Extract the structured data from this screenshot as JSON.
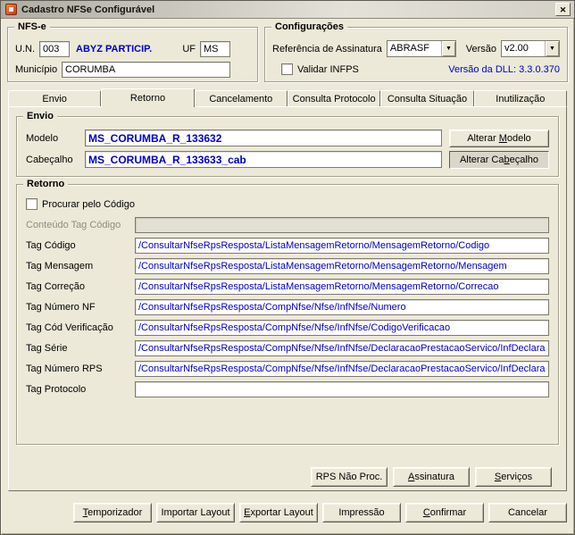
{
  "window": {
    "title": "Cadastro NFSe Configurável"
  },
  "icons": {
    "close": "✕",
    "dropdown": "▼"
  },
  "colors": {
    "accent_blue": "#0000C8",
    "dialog_bg": "#ECE9D8"
  },
  "nfse": {
    "title": "NFS-e",
    "un_label": "U.N.",
    "un_value": "003",
    "participante": "ABYZ PARTICIP.",
    "uf_label": "UF",
    "uf_value": "MS",
    "municipio_label": "Município",
    "municipio_value": "CORUMBA"
  },
  "config": {
    "title": "Configurações",
    "referencia_label": "Referência de Assinatura",
    "referencia_value": "ABRASF",
    "versao_label": "Versão",
    "versao_value": "v2.00",
    "validar_infps_label": "Validar INFPS",
    "dll_versao": "Versão da DLL: 3.3.0.370"
  },
  "tabs": [
    "Envio",
    "Retorno",
    "Cancelamento",
    "Consulta Protocolo",
    "Consulta Situação",
    "Inutilização"
  ],
  "active_tab": "Retorno",
  "envio": {
    "title": "Envio",
    "modelo_label": "Modelo",
    "modelo_value": "MS_CORUMBA_R_133632",
    "alterar_modelo": {
      "label": "Alterar Modelo",
      "accel": 8
    },
    "cabecalho_label": "Cabeçalho",
    "cabecalho_value": "MS_CORUMBA_R_133633_cab",
    "alterar_cabecalho": {
      "label": "Alterar Cabeçalho",
      "accel": 10
    }
  },
  "retorno": {
    "title": "Retorno",
    "procurar_label": "Procurar pelo Código",
    "rows": [
      {
        "label": "Conteúdo Tag Código",
        "value": "",
        "disabled": true
      },
      {
        "label": "Tag Código",
        "value": "/ConsultarNfseRpsResposta/ListaMensagemRetorno/MensagemRetorno/Codigo"
      },
      {
        "label": "Tag Mensagem",
        "value": "/ConsultarNfseRpsResposta/ListaMensagemRetorno/MensagemRetorno/Mensagem"
      },
      {
        "label": "Tag Correção",
        "value": "/ConsultarNfseRpsResposta/ListaMensagemRetorno/MensagemRetorno/Correcao"
      },
      {
        "label": "Tag Número NF",
        "value": "/ConsultarNfseRpsResposta/CompNfse/Nfse/InfNfse/Numero"
      },
      {
        "label": "Tag Cód Verificação",
        "value": "/ConsultarNfseRpsResposta/CompNfse/Nfse/InfNfse/CodigoVerificacao"
      },
      {
        "label": "Tag Série",
        "value": "/ConsultarNfseRpsResposta/CompNfse/Nfse/InfNfse/DeclaracaoPrestacaoServico/InfDeclarac"
      },
      {
        "label": "Tag Número RPS",
        "value": "/ConsultarNfseRpsResposta/CompNfse/Nfse/InfNfse/DeclaracaoPrestacaoServico/InfDeclarac"
      },
      {
        "label": "Tag Protocolo",
        "value": ""
      }
    ]
  },
  "page_buttons": [
    {
      "label": "RPS Não Proc.",
      "accel": -1
    },
    {
      "label": "Assinatura",
      "accel": 0
    },
    {
      "label": "Serviços",
      "accel": 0
    }
  ],
  "bottom_buttons": [
    {
      "label": "Temporizador",
      "accel": 0
    },
    {
      "label": "Importar Layout",
      "accel": -1
    },
    {
      "label": "Exportar Layout",
      "accel": 0
    },
    {
      "label": "Impressão",
      "accel": -1
    },
    {
      "label": "Confirmar",
      "accel": 0
    },
    {
      "label": "Cancelar",
      "accel": -1
    }
  ]
}
